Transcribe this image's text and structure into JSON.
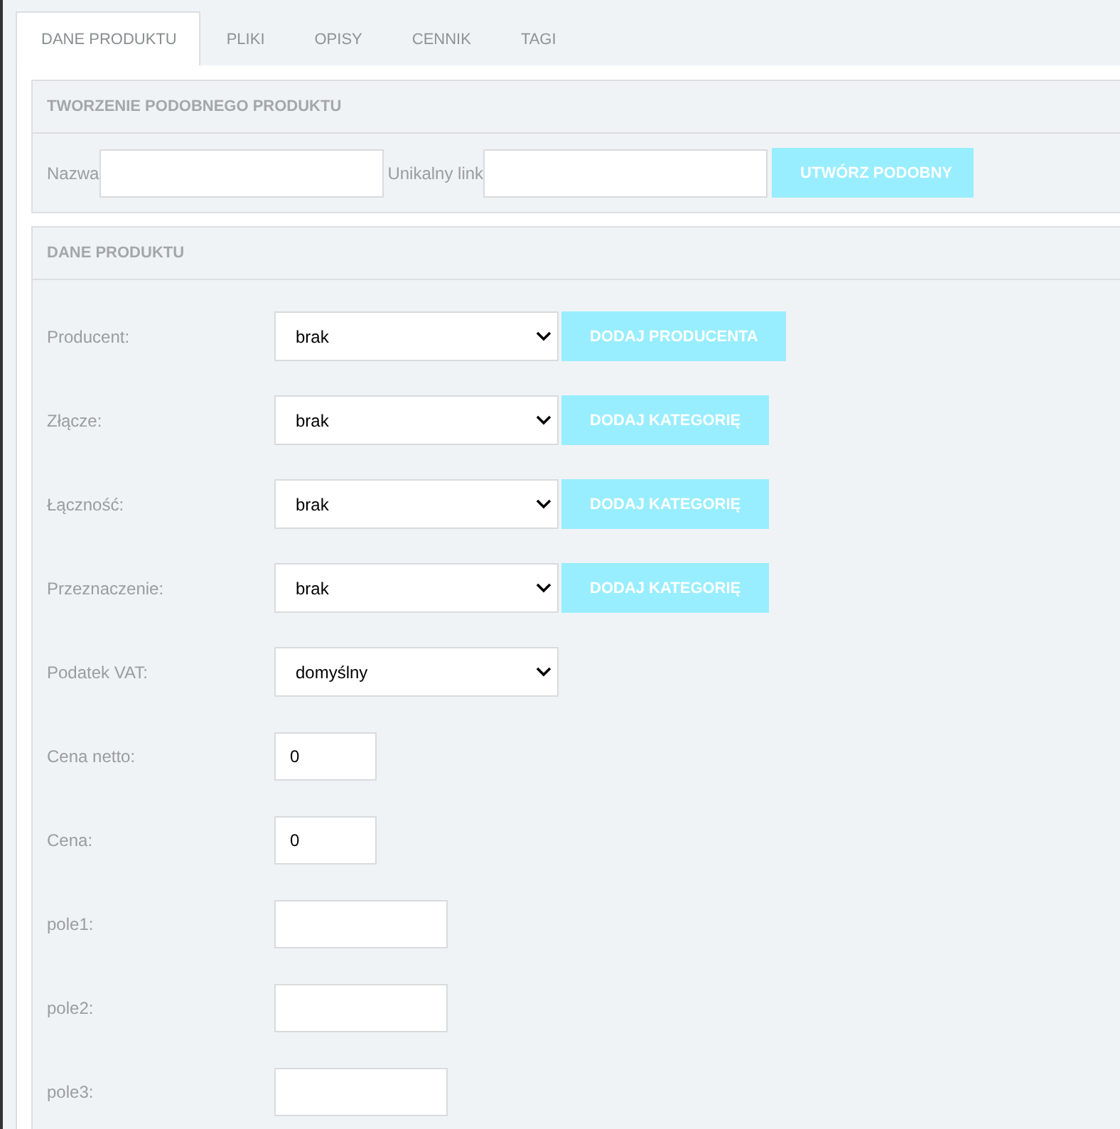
{
  "tabs": [
    {
      "label": "DANE PRODUKTU",
      "selected": true
    },
    {
      "label": "PLIKI",
      "selected": false
    },
    {
      "label": "OPISY",
      "selected": false
    },
    {
      "label": "CENNIK",
      "selected": false
    },
    {
      "label": "TAGI",
      "selected": false
    }
  ],
  "similar_product": {
    "title": "TWORZENIE PODOBNEGO PRODUKTU",
    "name_label": "Nazwa",
    "link_label": "Unikalny link",
    "button": "UTWÓRZ PODOBNY"
  },
  "product_data": {
    "title": "DANE PRODUKTU",
    "rows": [
      {
        "kind": "select",
        "label": "Producent:",
        "value": "brak",
        "button": "DODAJ PRODUCENTA"
      },
      {
        "kind": "select",
        "label": "Złącze:",
        "value": "brak",
        "button": "DODAJ KATEGORIĘ"
      },
      {
        "kind": "select",
        "label": "Łączność:",
        "value": "brak",
        "button": "DODAJ KATEGORIĘ"
      },
      {
        "kind": "select",
        "label": "Przeznaczenie:",
        "value": "brak",
        "button": "DODAJ KATEGORIĘ"
      },
      {
        "kind": "select",
        "label": "Podatek VAT:",
        "value": "domyślny"
      },
      {
        "kind": "number",
        "label": "Cena netto:",
        "value": "0"
      },
      {
        "kind": "number",
        "label": "Cena:",
        "value": "0"
      },
      {
        "kind": "text",
        "label": "pole1:"
      },
      {
        "kind": "text",
        "label": "pole2:"
      },
      {
        "kind": "text",
        "label": "pole3:"
      }
    ]
  }
}
